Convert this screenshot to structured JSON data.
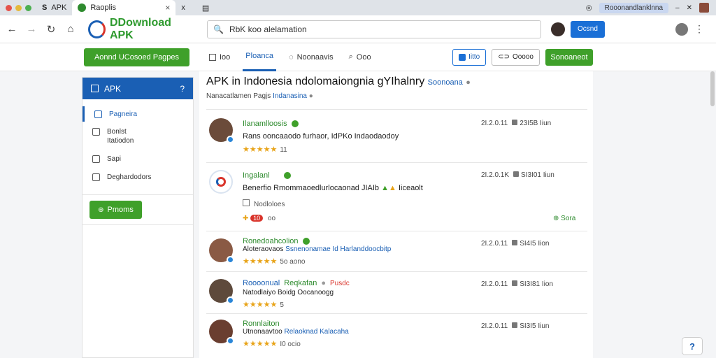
{
  "browser": {
    "tabs": [
      {
        "label": "APK"
      },
      {
        "label": "Raoplis"
      }
    ],
    "window_title": "Rooonandlanklnna",
    "tab_close": "×",
    "new_tab": "x"
  },
  "toolbar": {
    "logo_text": "DDownload APK",
    "search_value": "RbK koo alelamation",
    "primary_button": "Ocsnd"
  },
  "subnav": {
    "left_button": "Aonnd UCosoed Pagpes",
    "tabs": [
      {
        "label": "Ioo",
        "active": false
      },
      {
        "label": "Ploanca",
        "active": true
      },
      {
        "label": "Noonaavis",
        "active": false
      },
      {
        "label": "Ooo",
        "active": false
      }
    ],
    "btn_primary_outline": "Iitto",
    "btn_outline": "Ooooo",
    "btn_green": "Sonoaneot"
  },
  "sidebar": {
    "header": "APK",
    "header_icon": "?",
    "items": [
      {
        "label": "Pagneira",
        "active": true
      },
      {
        "label": "Bonlst\nItatiodon",
        "active": false
      },
      {
        "label": "Sapi",
        "active": false
      },
      {
        "label": "Deghardodors",
        "active": false
      }
    ],
    "action_button": "Pmoms"
  },
  "main": {
    "title": "APK in Indonesia ndolomaiongnia gYIhalnry",
    "title_link": "Soonoana",
    "subtitle": "Nanacatlamen Pagjs",
    "subtitle_link": "Indanasina",
    "rows": [
      {
        "name": "Ilanamlloosis",
        "desc": "Rans ooncaaodo furhaor, IdPKo Indaodaodoy",
        "desc_link": "",
        "extra": "",
        "stars": "★★★★★",
        "count": "11",
        "date": "2I.2.0.11",
        "size": "23I5B",
        "unit": "Iiun"
      },
      {
        "name": "Ingalanl",
        "desc": "Benerfio Rmommaoedlurlocaonad JIAIb",
        "desc_link": "",
        "extra": "Iiceaolt",
        "stars": "",
        "count": "",
        "date": "2I.2.0.1K",
        "size": "SI3I01",
        "unit": "Iiun",
        "sub": "Nodloloes",
        "sub_count": "oo",
        "sub_badge": "10",
        "action": "Sora"
      },
      {
        "name": "Ronedoahcolion",
        "desc": "Aloteraovaos",
        "desc_link": "Ssnenonamae Id Harlanddoocbitp",
        "extra": "",
        "stars": "★★★★★",
        "count": "5o aono",
        "date": "2I.2.0.11",
        "size": "SI4I5",
        "unit": "Iion"
      },
      {
        "name": "Roooonual",
        "name2": "Reqkafan",
        "name3": "Pusdc",
        "desc": "Natodlaiyo Boidg Oocanoogg",
        "desc_link": "",
        "extra": "",
        "stars": "★★★★★",
        "count": "5",
        "date": "2I.2.0.11",
        "size": "SI3I81",
        "unit": "Iion"
      },
      {
        "name": "Ronnlaiton",
        "desc": "Utnonaavtoo",
        "desc_link": "Relaoknad Kalacaha",
        "extra": "",
        "stars": "★★★★★",
        "count": "I0 ocio",
        "date": "2I.2.0.11",
        "size": "SI3I5",
        "unit": "Iiun"
      }
    ]
  },
  "help_label": "?"
}
